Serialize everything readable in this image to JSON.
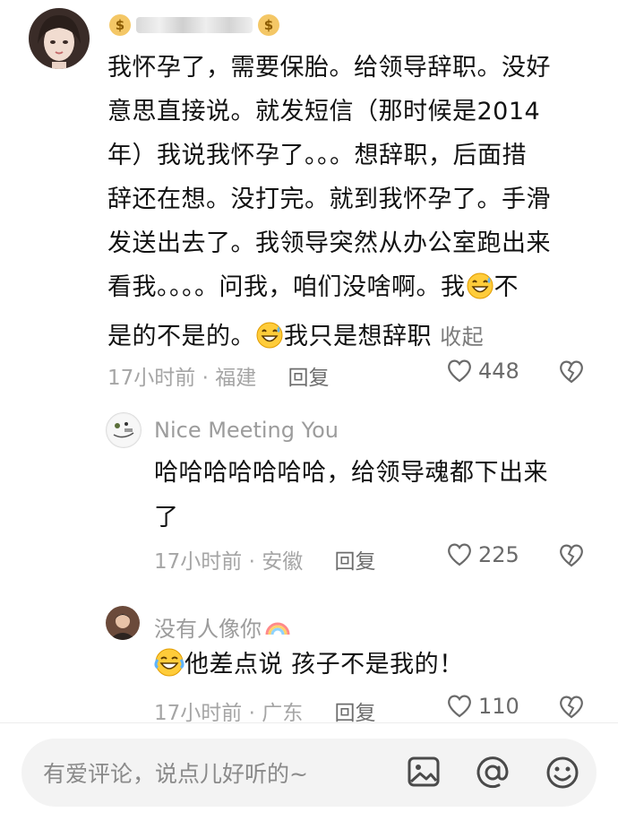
{
  "comment": {
    "author_redacted": true,
    "text_lines": [
      "我怀孕了，需要保胎。给领导辞职。没好",
      "意思直接说。就发短信（那时候是2014",
      "年）我说我怀孕了。。。想辞职，后面措",
      "辞还在想。没打完。就到我怀孕了。手滑",
      "发送出去了。我领导突然从办公室跑出来",
      "看我。。。。问我，咱们没啥啊。我",
      "不",
      "是的不是的。",
      "我只是想辞职"
    ],
    "collapse_label": "收起",
    "time": "17小时前",
    "location": "福建",
    "reply_label": "回复",
    "likes": "448"
  },
  "replies": [
    {
      "name": "Nice Meeting You",
      "text_line1": "哈哈哈哈哈哈哈，给领导魂都下出来",
      "text_line2": "了",
      "time": "17小时前",
      "location": "安徽",
      "reply_label": "回复",
      "likes": "225"
    },
    {
      "name": "没有人像你",
      "text": "他差点说 孩子不是我的！",
      "time": "17小时前",
      "location": "广东",
      "reply_label": "回复",
      "likes": "110"
    }
  ],
  "dot_sep": "·",
  "input": {
    "placeholder": "有爱评论，说点儿好听的~"
  },
  "icons": [
    "image-icon",
    "at-icon",
    "emoji-icon",
    "heart-icon",
    "broken-heart-icon",
    "sweat-smile-emoji",
    "laugh-cry-emoji",
    "rainbow-icon",
    "money-bag-icon"
  ]
}
